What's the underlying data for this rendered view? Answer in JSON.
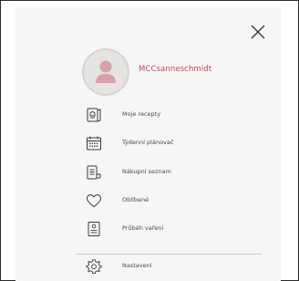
{
  "profile": {
    "username": "MCCsanneschmidt"
  },
  "menu": {
    "items": [
      {
        "label": "Moje recepty",
        "icon": "recipe-book-icon"
      },
      {
        "label": "Týdenní plánovač",
        "icon": "calendar-icon"
      },
      {
        "label": "Nákupní seznam",
        "icon": "shopping-list-icon"
      },
      {
        "label": "Oblíbené",
        "icon": "heart-icon"
      },
      {
        "label": "Průběh vaření",
        "icon": "cooking-progress-icon"
      }
    ],
    "settings": {
      "label": "Nastavení",
      "icon": "gear-icon"
    }
  },
  "colors": {
    "accent": "#c8465c",
    "panel": "#f6f6f6",
    "icon": "#3a3a3a"
  }
}
